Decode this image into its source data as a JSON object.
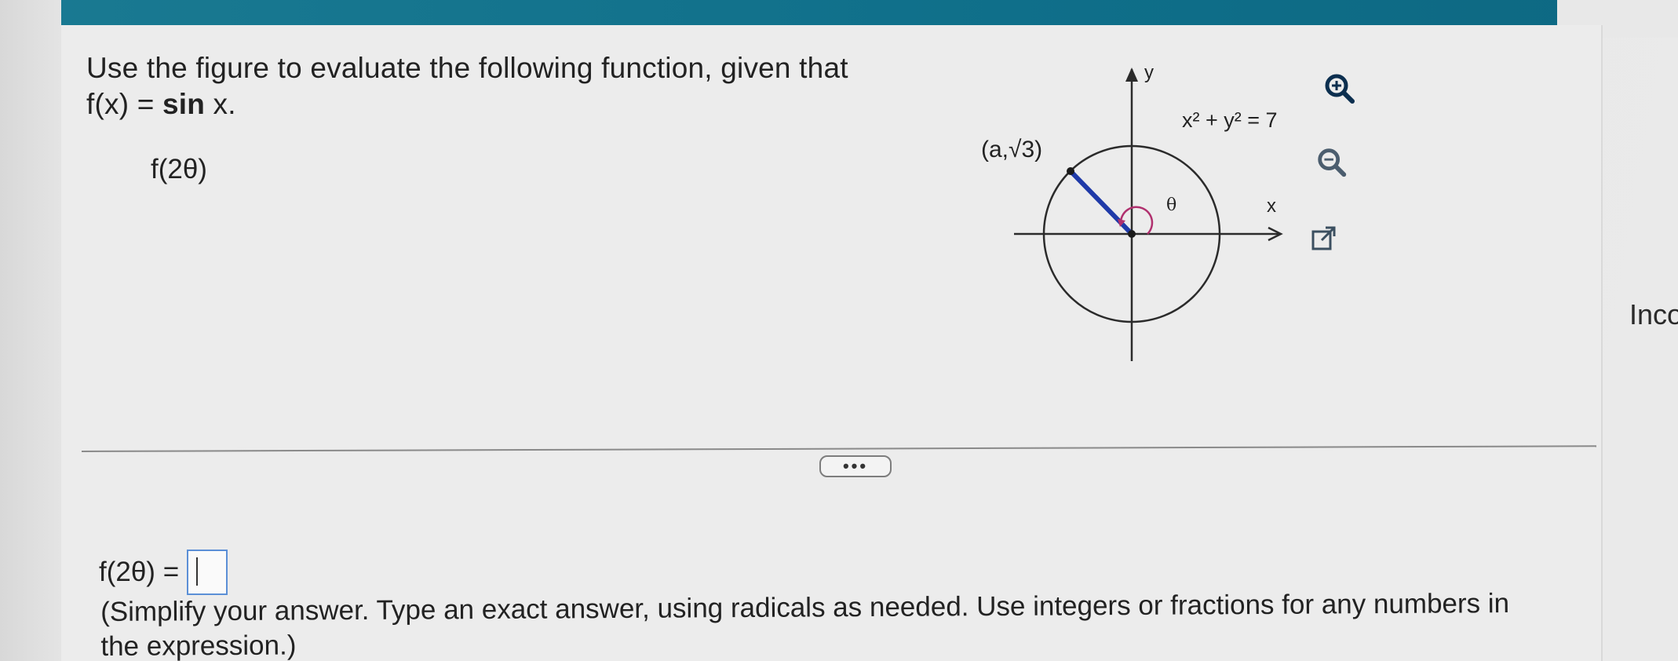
{
  "question": {
    "line1": "Use the figure to evaluate the following function, given that",
    "line2_prefix": "f(x) = ",
    "line2_fn": "sin",
    "line2_suffix": " x."
  },
  "expression": "f(2θ)",
  "figure": {
    "point_label": "(a,√3)",
    "equation": "x² + y² = 7",
    "y_label": "y",
    "x_label": "x",
    "angle_label": "θ"
  },
  "tools": {
    "zoom_in": "zoom-in-icon",
    "zoom_out": "zoom-out-icon",
    "popout": "external-link-icon"
  },
  "side_label": "Inco",
  "more_button": "•••",
  "answer": {
    "prefix": "f(2θ) =",
    "value": ""
  },
  "hint": "(Simplify your answer. Type an exact answer, using radicals as needed. Use integers or fractions for any numbers in the expression.)",
  "colors": {
    "header": "#0f6f8a",
    "radius_line": "#1f3aa8",
    "angle_arc": "#b0306e",
    "input_border": "#5b8fd6"
  }
}
